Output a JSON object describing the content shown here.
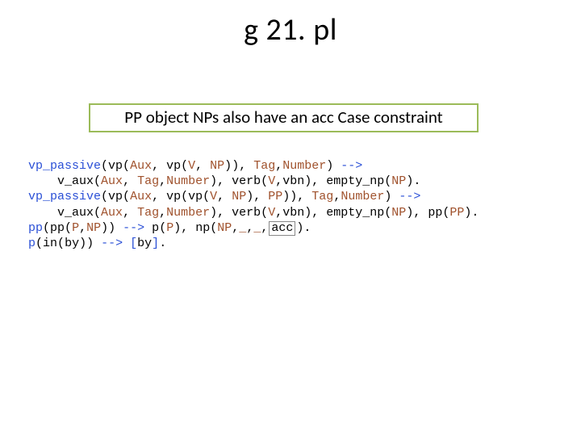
{
  "title": "g 21. pl",
  "caption": "PP object NPs also have an acc Case constraint",
  "code": {
    "t": {
      "vp_passive": "vp_passive",
      "v_aux": "v_aux",
      "verb": "verb",
      "empty_np": "empty_np",
      "pp": "pp",
      "np": "np",
      "p": "p",
      "vp": "vp",
      "in": "in"
    },
    "v": {
      "Aux": "Aux",
      "V": "V",
      "NP": "NP",
      "PP": "PP",
      "Tag": "Tag",
      "Number": "Number",
      "P": "P",
      "vbn": "vbn",
      "acc": "acc",
      "by": "by",
      "us": "_"
    },
    "s": {
      "arrow": " -->",
      "comma": ", ",
      "comma_t": ",",
      "dot": ".",
      "lp": "(",
      "rp": ")",
      "lb": "[",
      "rb": "]",
      "ind": "    "
    }
  }
}
